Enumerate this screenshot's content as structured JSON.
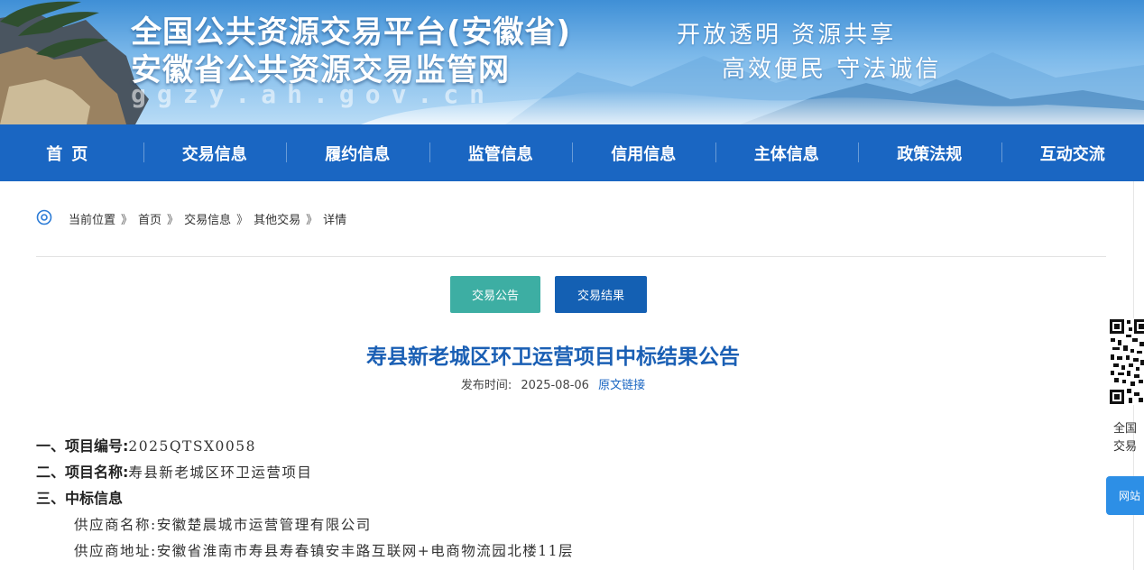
{
  "banner": {
    "title_line1": "全国公共资源交易平台(安徽省)",
    "title_line2": "安徽省公共资源交易监管网",
    "domain": "ggzy.ah.gov.cn",
    "slogan_line1": "开放透明  资源共享",
    "slogan_line2": "高效便民  守法诚信"
  },
  "nav": {
    "items": [
      {
        "label": "首页"
      },
      {
        "label": "交易信息"
      },
      {
        "label": "履约信息"
      },
      {
        "label": "监管信息"
      },
      {
        "label": "信用信息"
      },
      {
        "label": "主体信息"
      },
      {
        "label": "政策法规"
      },
      {
        "label": "互动交流"
      }
    ]
  },
  "breadcrumb": {
    "prefix": "当前位置",
    "sep": "》",
    "items": [
      {
        "label": "首页"
      },
      {
        "label": "交易信息"
      },
      {
        "label": "其他交易"
      },
      {
        "label": "详情"
      }
    ]
  },
  "tabs": {
    "announcement": "交易公告",
    "result": "交易结果"
  },
  "article": {
    "title": "寿县新老城区环卫运营项目中标结果公告",
    "publish_label": "发布时间:",
    "publish_date": "2025-08-06",
    "source_link": "原文链接"
  },
  "content": {
    "project_no_label": "一、项目编号:",
    "project_no": "2025QTSX0058",
    "project_name_label": "二、项目名称:",
    "project_name": "寿县新老城区环卫运营项目",
    "winner_label": "三、中标信息",
    "supplier_name_label": "供应商名称:",
    "supplier_name": "安徽楚晨城市运营管理有限公司",
    "supplier_addr_label": "供应商地址:",
    "supplier_addr": "安徽省淮南市寿县寿春镇安丰路互联网+电商物流园北楼11层"
  },
  "side": {
    "qr_caption_line1": "全国",
    "qr_caption_line2": "交易",
    "button_label": "网站"
  },
  "colors": {
    "nav_bg": "#1a66c2",
    "title": "#1a5fb4",
    "tab_announcement": "#3daea3",
    "tab_result": "#1460b3"
  }
}
